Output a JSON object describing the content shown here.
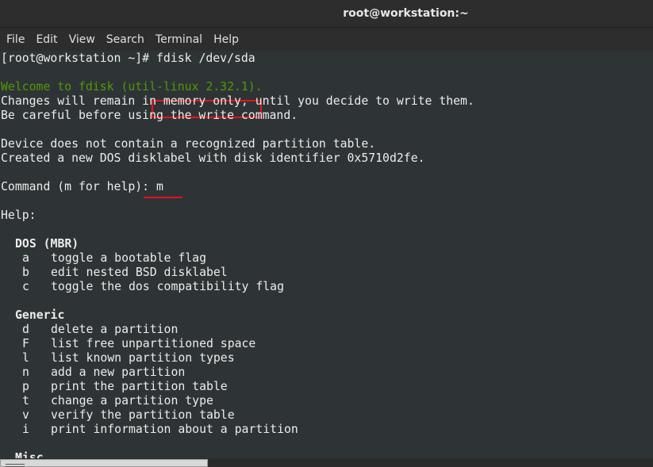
{
  "window": {
    "title": "root@workstation:~"
  },
  "menu": [
    "File",
    "Edit",
    "View",
    "Search",
    "Terminal",
    "Help"
  ],
  "terminal": {
    "prompt": "[root@workstation ~]# ",
    "command": "fdisk /dev/sda",
    "welcome": "Welcome to fdisk (util-linux 2.32.1).",
    "changes_note": "Changes will remain in memory only, until you decide to write them.",
    "careful_note": "Be careful before using the write command.",
    "no_table": "Device does not contain a recognized partition table.",
    "created_label": "Created a new DOS disklabel with disk identifier 0x5710d2fe.",
    "command_prompt": "Command (m for help): ",
    "command_input": "m",
    "help_header": "Help:",
    "sections": [
      {
        "title": "DOS (MBR)",
        "items": [
          {
            "key": "a",
            "desc": "toggle a bootable flag"
          },
          {
            "key": "b",
            "desc": "edit nested BSD disklabel"
          },
          {
            "key": "c",
            "desc": "toggle the dos compatibility flag"
          }
        ]
      },
      {
        "title": "Generic",
        "items": [
          {
            "key": "d",
            "desc": "delete a partition"
          },
          {
            "key": "F",
            "desc": "list free unpartitioned space"
          },
          {
            "key": "l",
            "desc": "list known partition types"
          },
          {
            "key": "n",
            "desc": "add a new partition"
          },
          {
            "key": "p",
            "desc": "print the partition table"
          },
          {
            "key": "t",
            "desc": "change a partition type"
          },
          {
            "key": "v",
            "desc": "verify the partition table"
          },
          {
            "key": "i",
            "desc": "print information about a partition"
          }
        ]
      },
      {
        "title": "Misc",
        "items": []
      }
    ]
  },
  "colors": {
    "terminal_bg": "#2e3436",
    "text": "#ececec",
    "green_text": "#4e9a06",
    "highlight_red": "#e8121b"
  }
}
